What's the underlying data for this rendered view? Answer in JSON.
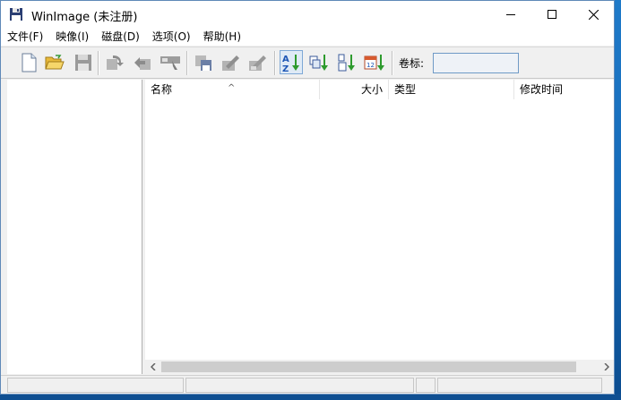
{
  "window": {
    "title": "WinImage (未注册)"
  },
  "menu": [
    "文件(F)",
    "映像(I)",
    "磁盘(D)",
    "选项(O)",
    "帮助(H)"
  ],
  "toolbar": {
    "volume_label": "卷标:",
    "volume_value": ""
  },
  "list": {
    "columns": [
      "名称",
      "大小",
      "类型",
      "修改时间"
    ],
    "sort_indicator": "^",
    "rows": []
  },
  "status": [
    "",
    "",
    "",
    ""
  ]
}
